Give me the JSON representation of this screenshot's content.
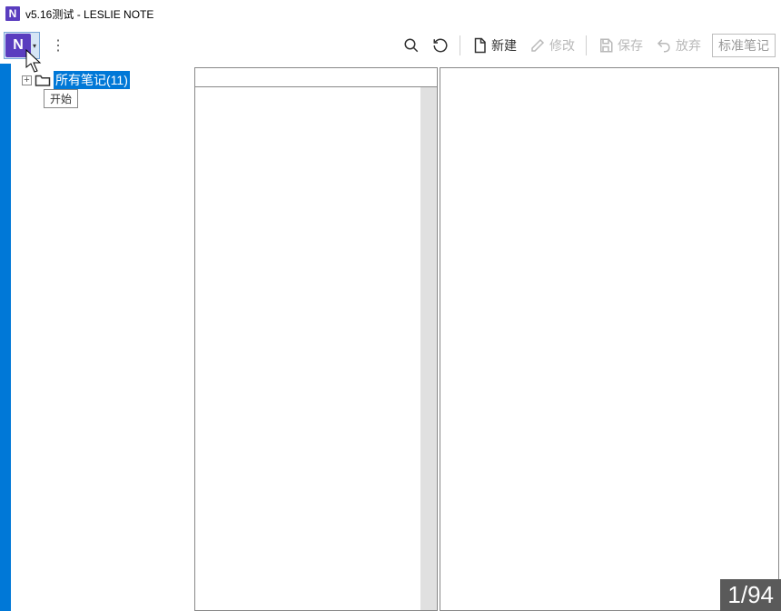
{
  "title": "v5.16测试 - LESLIE NOTE",
  "appLogoLetter": "N",
  "toolbar": {
    "search": "",
    "refresh": "",
    "new": "新建",
    "edit": "修改",
    "save": "保存",
    "discard": "放弃",
    "typeLabel": "标准笔记"
  },
  "tree": {
    "rootLabel": "所有笔记(11)",
    "tooltip": "开始"
  },
  "pager": "1/94"
}
